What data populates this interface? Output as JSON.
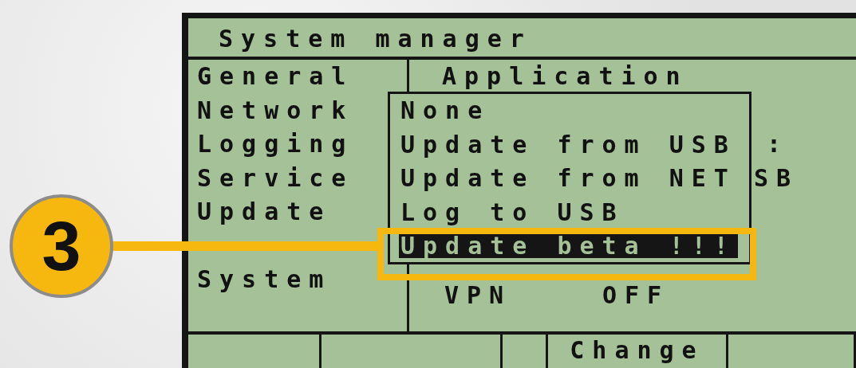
{
  "screen": {
    "title": "System manager",
    "menu": [
      {
        "label": "General",
        "selected": false
      },
      {
        "label": "Network",
        "selected": false
      },
      {
        "label": "Logging",
        "selected": false
      },
      {
        "label": "Service",
        "selected": false
      },
      {
        "label": "Update",
        "selected": false
      },
      {
        "label": "System",
        "selected": false
      }
    ],
    "panel": {
      "heading": "Application",
      "value_fragments": [
        ":",
        "SB"
      ],
      "vpn_row": {
        "label": "VPN",
        "value": "OFF"
      }
    },
    "dropdown": {
      "options": [
        {
          "label": "None",
          "selected": false
        },
        {
          "label": "Update from USB",
          "selected": false
        },
        {
          "label": "Update from NET",
          "selected": false
        },
        {
          "label": "Log to USB",
          "selected": false
        },
        {
          "label": "Update beta !!!",
          "selected": true
        }
      ]
    },
    "softkeys": {
      "slot_4": "Change"
    }
  },
  "callout": {
    "number": "3"
  }
}
